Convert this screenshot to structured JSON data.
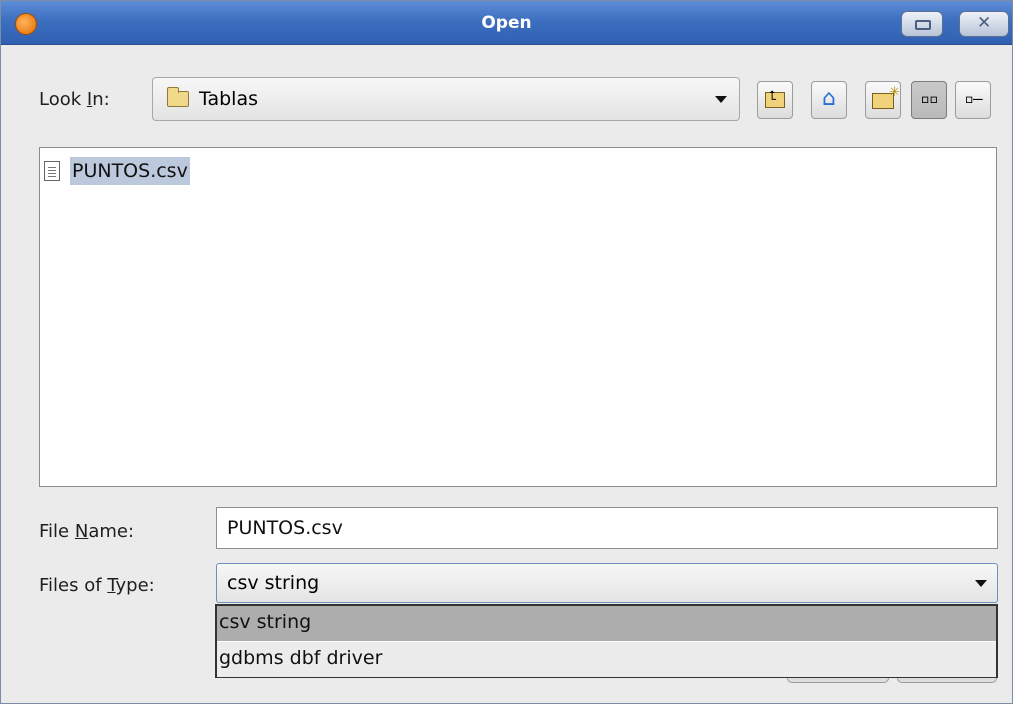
{
  "window": {
    "title": "Open"
  },
  "toolbar": {
    "look_in_label_pre": "Look ",
    "look_in_label_mnemonic": "I",
    "look_in_label_post": "n:",
    "look_in_value": "Tablas",
    "buttons": [
      "up-one-level",
      "home",
      "create-new-folder",
      "list-view",
      "details-view"
    ]
  },
  "files": [
    {
      "name": "PUNTOS.csv",
      "selected": true
    }
  ],
  "form": {
    "file_name_label_pre": "File ",
    "file_name_label_mnemonic": "N",
    "file_name_label_post": "ame:",
    "file_name_value": "PUNTOS.csv",
    "file_type_label_pre": "Files of ",
    "file_type_label_mnemonic": "T",
    "file_type_label_post": "ype:",
    "file_type_value": "csv string"
  },
  "dropdown": {
    "options": [
      "csv string",
      "gdbms dbf driver"
    ],
    "selected_index": 0
  },
  "colors": {
    "titlebar": "#3d6fc0",
    "selection": "#bcc8dc",
    "dropdown_selected": "#adadad"
  }
}
